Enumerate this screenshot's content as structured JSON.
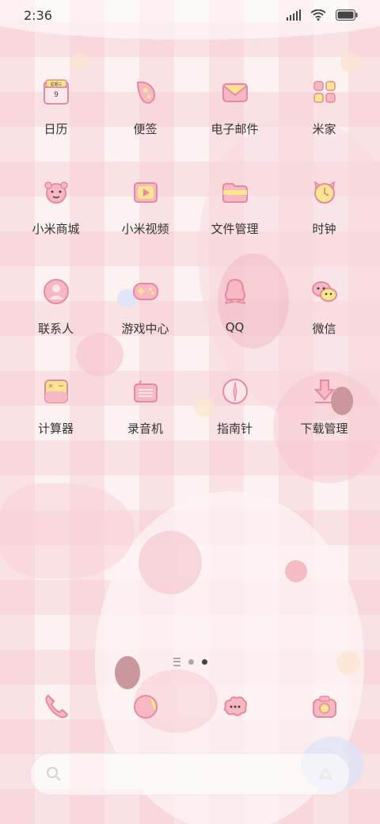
{
  "status_bar": {
    "time": "2:36"
  },
  "calendar_badge": {
    "weekday": "星期三",
    "day": "9"
  },
  "apps": [
    {
      "id": "calendar",
      "label": "日历",
      "icon": "calendar-icon"
    },
    {
      "id": "notes",
      "label": "便签",
      "icon": "notes-icon"
    },
    {
      "id": "email",
      "label": "电子邮件",
      "icon": "email-icon"
    },
    {
      "id": "mijia",
      "label": "米家",
      "icon": "mijia-icon"
    },
    {
      "id": "mall",
      "label": "小米商城",
      "icon": "mall-icon"
    },
    {
      "id": "video",
      "label": "小米视频",
      "icon": "video-icon"
    },
    {
      "id": "files",
      "label": "文件管理",
      "icon": "folder-icon"
    },
    {
      "id": "clock",
      "label": "时钟",
      "icon": "alarm-clock-icon"
    },
    {
      "id": "contacts",
      "label": "联系人",
      "icon": "contacts-icon"
    },
    {
      "id": "games",
      "label": "游戏中心",
      "icon": "gamepad-icon"
    },
    {
      "id": "qq",
      "label": "QQ",
      "icon": "qq-icon"
    },
    {
      "id": "wechat",
      "label": "微信",
      "icon": "wechat-icon"
    },
    {
      "id": "calculator",
      "label": "计算器",
      "icon": "calculator-icon"
    },
    {
      "id": "recorder",
      "label": "录音机",
      "icon": "recorder-icon"
    },
    {
      "id": "compass",
      "label": "指南针",
      "icon": "compass-icon"
    },
    {
      "id": "downloads",
      "label": "下载管理",
      "icon": "download-icon"
    }
  ],
  "dock": [
    {
      "id": "phone",
      "icon": "phone-icon"
    },
    {
      "id": "browser",
      "icon": "browser-icon"
    },
    {
      "id": "messages",
      "icon": "messages-icon"
    },
    {
      "id": "camera",
      "icon": "camera-icon"
    }
  ],
  "page_indicator": {
    "pages": 2,
    "active": 2
  },
  "colors": {
    "icon_pink": "#f4a9b8",
    "icon_yellow": "#fbe58d",
    "outline": "#e58aa0"
  }
}
